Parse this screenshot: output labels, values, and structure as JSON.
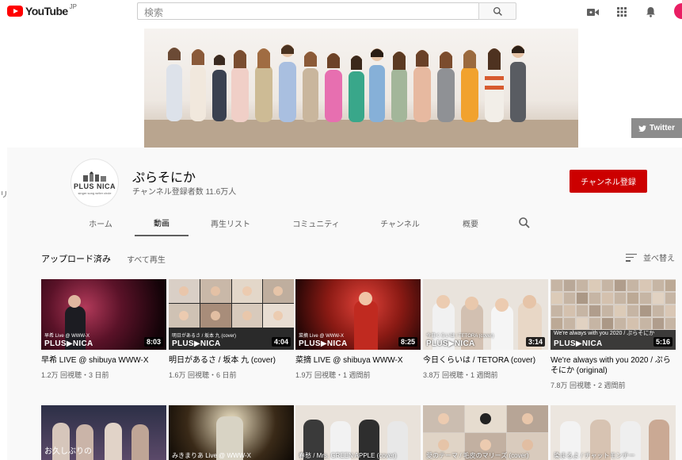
{
  "topbar": {
    "logo_text": "YouTube",
    "region": "JP",
    "search_placeholder": "検索"
  },
  "banner": {
    "twitter_label": "Twitter"
  },
  "channel": {
    "name": "ぷらそにか",
    "subscribers": "チャンネル登録者数 11.6万人",
    "subscribe_label": "チャンネル登録",
    "avatar_logo": "PLUS NICA",
    "avatar_tag": "singer song writer circle"
  },
  "left_edge_text": "リ",
  "tabs": [
    {
      "label": "ホーム"
    },
    {
      "label": "動画"
    },
    {
      "label": "再生リスト"
    },
    {
      "label": "コミュニティ"
    },
    {
      "label": "チャンネル"
    },
    {
      "label": "概要"
    }
  ],
  "section": {
    "title": "アップロード済み",
    "play_all": "すべて再生",
    "sort_label": "並べ替え"
  },
  "videos": [
    {
      "title": "早希 LIVE @ shibuya WWW-X",
      "meta": "1.2万 回視聴・3 日前",
      "duration": "8:03",
      "overlay": "早希 Live @ WWW-X",
      "brand": "PLUS▶NICA"
    },
    {
      "title": "明日があるさ / 坂本 九 (cover)",
      "meta": "1.6万 回視聴・6 日前",
      "duration": "4:04",
      "overlay": "明日があるさ / 坂本 九 (cover)",
      "brand": "PLUS▶NICA"
    },
    {
      "title": "菜摘 LIVE @ shibuya WWW-X",
      "meta": "1.9万 回視聴・1 週間前",
      "duration": "8:25",
      "overlay": "菜摘 Live @ WWW-X",
      "brand": "PLUS▶NICA"
    },
    {
      "title": "今日くらいは / TETORA (cover)",
      "meta": "3.8万 回視聴・1 週間前",
      "duration": "3:14",
      "overlay": "今日くらいは / TETORA (cover)",
      "brand": "PLUS▶NICA"
    },
    {
      "title": "We're always with you 2020 / ぷらそにか (original)",
      "meta": "7.8万 回視聴・2 週間前",
      "duration": "5:16",
      "overlay": "We're always with you 2020 / ぷらそにか",
      "brand": "PLUS▶NICA"
    }
  ],
  "row2": [
    {
      "caption": "お久しぶりの"
    },
    {
      "caption": "みきまりあ Live @ WWW-X"
    },
    {
      "caption": "春愁 / Mrs. GREEN APPLE (cover)"
    },
    {
      "caption": "愛のテーマ / 毛皮のマリーズ (cover)"
    },
    {
      "caption": "染まるよ / チャットモンチー"
    }
  ],
  "colors": {
    "brand_red": "#ff0000",
    "subscribe_red": "#cc0000"
  }
}
